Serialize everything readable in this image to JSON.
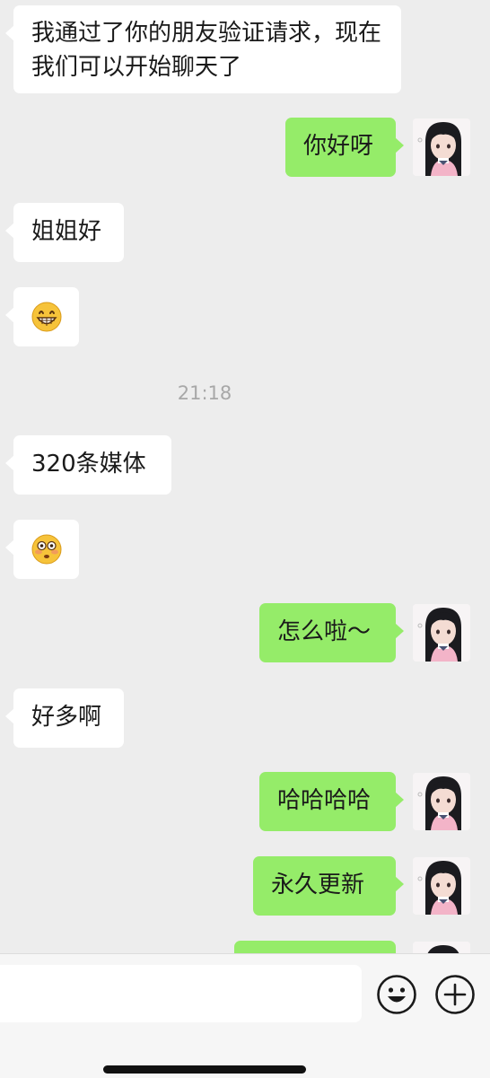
{
  "messages": [
    {
      "text": "我通过了你的朋友验证请求，现在我们可以开始聊天了"
    },
    {
      "text": "你好呀"
    },
    {
      "text": "姐姐好"
    },
    {
      "emoji": "grinning-face"
    },
    {
      "text": "320条媒体"
    },
    {
      "emoji": "flushed-face"
    },
    {
      "text": "怎么啦～"
    },
    {
      "text": "好多啊"
    },
    {
      "text": "哈哈哈哈"
    },
    {
      "text": "永久更新"
    }
  ],
  "timestamp": "21:18",
  "input_bar": {
    "message_value": "",
    "emoji_icon": "smiley-icon",
    "more_icon": "plus-circle-icon"
  },
  "colors": {
    "background": "#ededed",
    "incoming_bubble": "#ffffff",
    "outgoing_bubble": "#95ec69",
    "timestamp": "#a8a8a8"
  }
}
